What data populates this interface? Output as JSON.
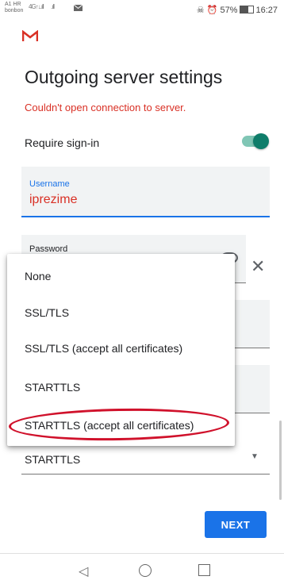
{
  "status_bar": {
    "carrier_line1": "A1 HR",
    "carrier_line2": "bonbon",
    "signal1": "4G↑↓.ıll",
    "signal2": ".ıll",
    "right_text": "☠ ⏰ 57%",
    "time": "16:27",
    "battery_percent": 57
  },
  "page": {
    "title": "Outgoing server settings",
    "error": "Couldn't open connection to server.",
    "require_signin_label": "Require sign-in",
    "require_signin_on": true
  },
  "username_field": {
    "label": "Username",
    "value": "iprezime"
  },
  "password_field": {
    "label": "Password"
  },
  "security_select": {
    "selected": "STARTTLS",
    "options": [
      "None",
      "SSL/TLS",
      "SSL/TLS (accept all certificates)",
      "STARTTLS",
      "STARTTLS (accept all certificates)"
    ]
  },
  "buttons": {
    "next": "NEXT"
  },
  "colors": {
    "accent": "#1a73e8",
    "error": "#d93025",
    "toggle": "#0f7d6a",
    "highlight": "#d0112b"
  },
  "icons": {
    "gmail": "gmail-logo-icon",
    "eye": "eye-icon",
    "clear": "close-icon",
    "back": "nav-back-icon",
    "home": "nav-home-icon",
    "recent": "nav-recent-icon"
  }
}
